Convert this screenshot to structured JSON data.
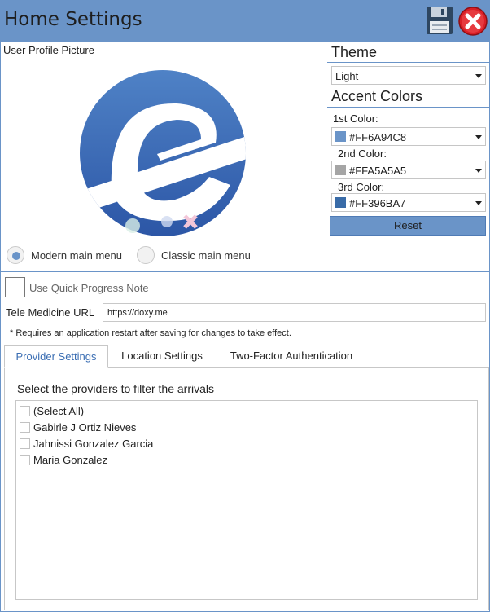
{
  "window": {
    "title": "Home Settings"
  },
  "icons": {
    "save": "save-disk-icon",
    "close": "close-icon"
  },
  "profile": {
    "label": "User Profile Picture"
  },
  "main_menu": {
    "modern_label": "Modern main menu",
    "classic_label": "Classic main menu",
    "selected": "modern"
  },
  "theme": {
    "heading": "Theme",
    "value": "Light"
  },
  "accent": {
    "heading": "Accent Colors",
    "first_label": "1st Color:",
    "first_value": "#FF6A94C8",
    "first_hex": "#6A94C8",
    "second_label": "2nd Color:",
    "second_value": "#FFA5A5A5",
    "second_hex": "#A5A5A5",
    "third_label": "3rd Color:",
    "third_value": "#FF396BA7",
    "third_hex": "#396BA7",
    "reset_label": "Reset"
  },
  "settings": {
    "quick_progress_label": "Use Quick Progress Note",
    "quick_progress_checked": false,
    "tele_label": "Tele Medicine URL",
    "tele_value": "https://doxy.me",
    "note": "* Requires an application restart after saving for changes to take effect."
  },
  "tabs": [
    {
      "label": "Provider Settings",
      "active": true
    },
    {
      "label": "Location Settings",
      "active": false
    },
    {
      "label": "Two-Factor Authentication",
      "active": false
    }
  ],
  "providers": {
    "heading": "Select the providers to filter the arrivals",
    "items": [
      {
        "label": "(Select All)",
        "checked": false
      },
      {
        "label": "Gabirle J Ortiz Nieves",
        "checked": false
      },
      {
        "label": "Jahnissi Gonzalez Garcia",
        "checked": false
      },
      {
        "label": "Maria Gonzalez",
        "checked": false
      }
    ]
  },
  "colors": {
    "accent": "#6A94C8",
    "accent_dark": "#396BA7"
  }
}
